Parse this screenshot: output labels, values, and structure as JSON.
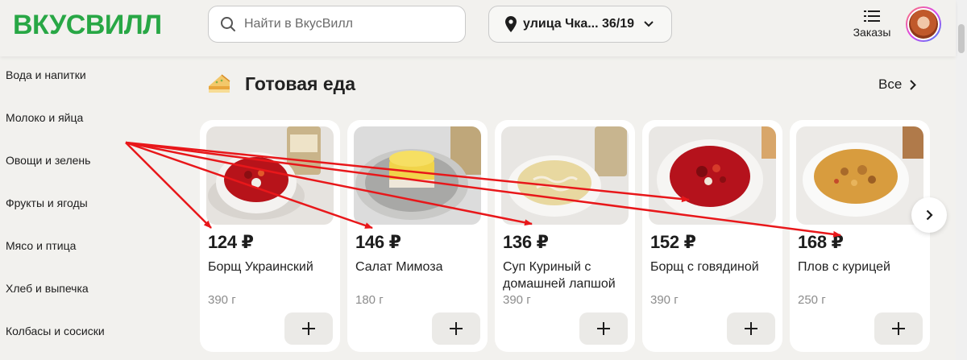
{
  "header": {
    "logo": "ВКУСВИЛЛ",
    "search_placeholder": "Найти в ВкусВилл",
    "address": "улица Чка... 36/19",
    "orders_label": "Заказы"
  },
  "sidebar": {
    "items": [
      {
        "label": "Вода и напитки"
      },
      {
        "label": "Молоко и яйца"
      },
      {
        "label": "Овощи и зелень"
      },
      {
        "label": "Фрукты и ягоды"
      },
      {
        "label": "Мясо и птица"
      },
      {
        "label": "Хлеб и выпечка"
      },
      {
        "label": "Колбасы и сосиски"
      }
    ]
  },
  "section": {
    "title": "Готовая еда",
    "see_all": "Все"
  },
  "products": [
    {
      "price": "124 ₽",
      "name": "Борщ Украинский",
      "weight": "390 г"
    },
    {
      "price": "146 ₽",
      "name": "Салат Мимоза",
      "weight": "180 г"
    },
    {
      "price": "136 ₽",
      "name": "Суп Куриный с домашней лапшой",
      "weight": "390 г"
    },
    {
      "price": "152 ₽",
      "name": "Борщ с говядиной",
      "weight": "390 г"
    },
    {
      "price": "168 ₽",
      "name": "Плов с курицей",
      "weight": "250 г"
    }
  ],
  "colors": {
    "brand": "#28a745",
    "annotation_arrow": "#e8171a",
    "background": "#f2f1ee"
  }
}
